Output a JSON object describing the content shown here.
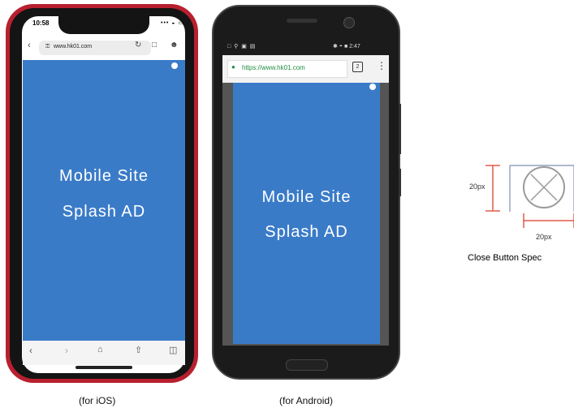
{
  "ios": {
    "time": "10:58",
    "status_icons": "••• ◒ ▭",
    "url": "www.hk01.com",
    "lock_icon": "🔒",
    "ad_line1": "Mobile Site",
    "ad_line2": "Splash AD",
    "caption": "(for iOS)"
  },
  "android": {
    "status_left": "□ ⚲ ▣ ▤",
    "status_right": "✱ ◓ ■ 2:47",
    "url": "https://www.hk01.com",
    "tab_count": "2",
    "ad_line1": "Mobile Site",
    "ad_line2": "Splash AD",
    "caption": "(for Android)"
  },
  "spec": {
    "label_height": "20px",
    "label_width": "20px",
    "title": "Close Button Spec"
  },
  "colors": {
    "ad_blue": "#3a7bc8",
    "ios_frame_red": "#b8202f",
    "dimension_red": "#e05a4a",
    "icon_gray": "#9a9a9a"
  }
}
